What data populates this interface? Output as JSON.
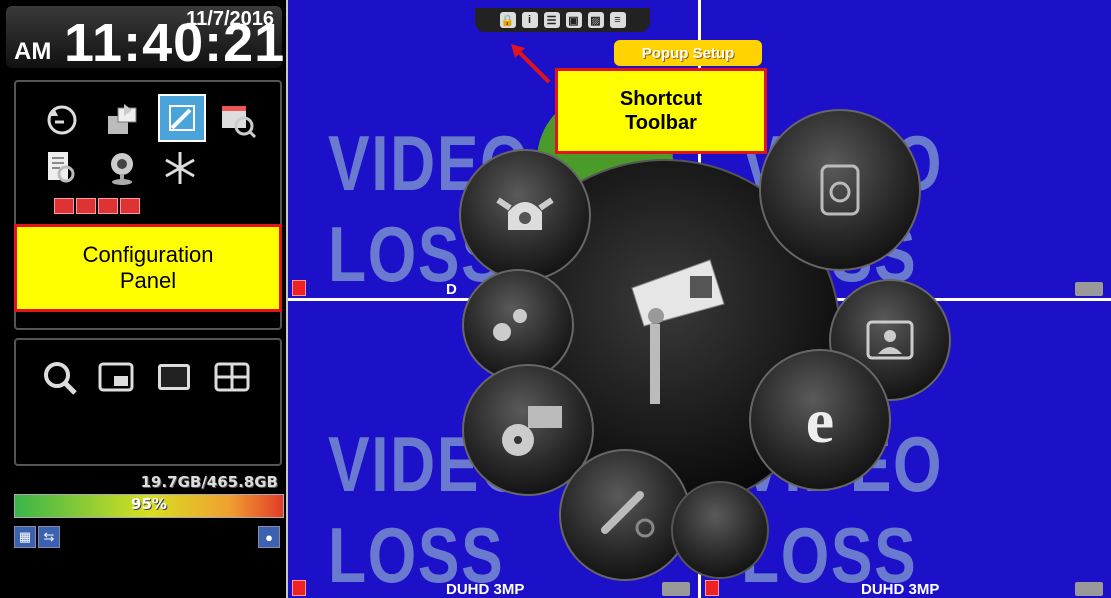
{
  "clock": {
    "date": "11/7/2016",
    "ampm": "AM",
    "time": "11:40:21"
  },
  "config_panel": {
    "icons": [
      "playback-icon",
      "export-icon",
      "setup-icon",
      "schedule-search-icon",
      "log-search-icon",
      "webcam-icon",
      "freeze-icon"
    ],
    "callout": [
      "Configuration",
      "Panel"
    ]
  },
  "view_panel": {
    "icons": [
      "search-icon",
      "pip-view-icon",
      "single-view-icon",
      "quad-view-icon"
    ]
  },
  "disk": {
    "usage": "19.7GB/465.8GB",
    "percent": "95%",
    "fill": 0.95
  },
  "toolbar": {
    "icons": [
      "lock-icon",
      "info-icon",
      "chat-icon",
      "display-icon",
      "image-icon",
      "list-icon"
    ],
    "popup": "Popup Setup",
    "callout": [
      "Shortcut",
      "Toolbar"
    ]
  },
  "cameras": {
    "video_loss": "VIDEO LOSS",
    "label_partial": "D",
    "label": "DUHD 3MP"
  },
  "colors": {
    "video_bg": "#1c10c9",
    "callout": "#ffff00",
    "callout_border": "#e0141c"
  }
}
